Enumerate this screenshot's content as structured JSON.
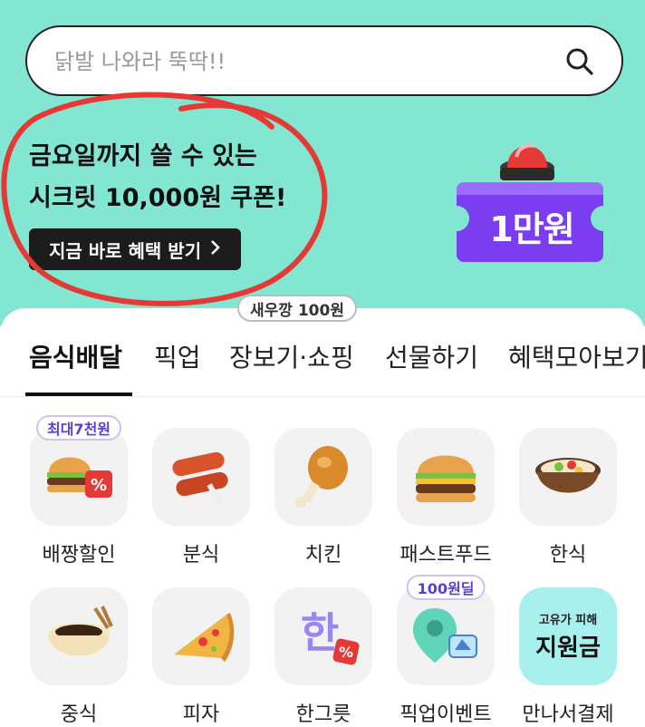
{
  "search": {
    "placeholder": "닭발 나와라 뚝딱!!"
  },
  "promo": {
    "line1": "금요일까지 쓸 수 있는",
    "line2": "시크릿 10,000원 쿠폰!",
    "button_label": "지금 바로 혜택 받기",
    "coupon_text": "1만원"
  },
  "top_badge": "새우깡 100원",
  "tabs": [
    {
      "label": "음식배달"
    },
    {
      "label": "픽업"
    },
    {
      "label": "장보기·쇼핑"
    },
    {
      "label": "선물하기"
    },
    {
      "label": "혜택모아보기"
    }
  ],
  "categories": [
    {
      "label": "배짱할인",
      "badge": "최대7천원",
      "icon": "burger-discount-icon"
    },
    {
      "label": "분식",
      "icon": "sausage-icon"
    },
    {
      "label": "치킨",
      "icon": "chicken-leg-icon"
    },
    {
      "label": "패스트푸드",
      "icon": "burger-icon"
    },
    {
      "label": "한식",
      "icon": "bibimbap-icon"
    },
    {
      "label": "중식",
      "icon": "jajangmyeon-icon"
    },
    {
      "label": "피자",
      "icon": "pizza-icon"
    },
    {
      "label": "한그릇",
      "icon": "han-discount-icon"
    },
    {
      "label": "픽업이벤트",
      "badge": "100원딜",
      "icon": "pickup-pin-icon"
    },
    {
      "label": "만나서결제",
      "tile_small": "고유가 피해",
      "tile_big": "지원금",
      "icon": "support-fund-tile"
    }
  ],
  "colors": {
    "hero_bg": "#83e6d2",
    "coupon": "#7a3df0",
    "accent_red": "#e53935"
  }
}
